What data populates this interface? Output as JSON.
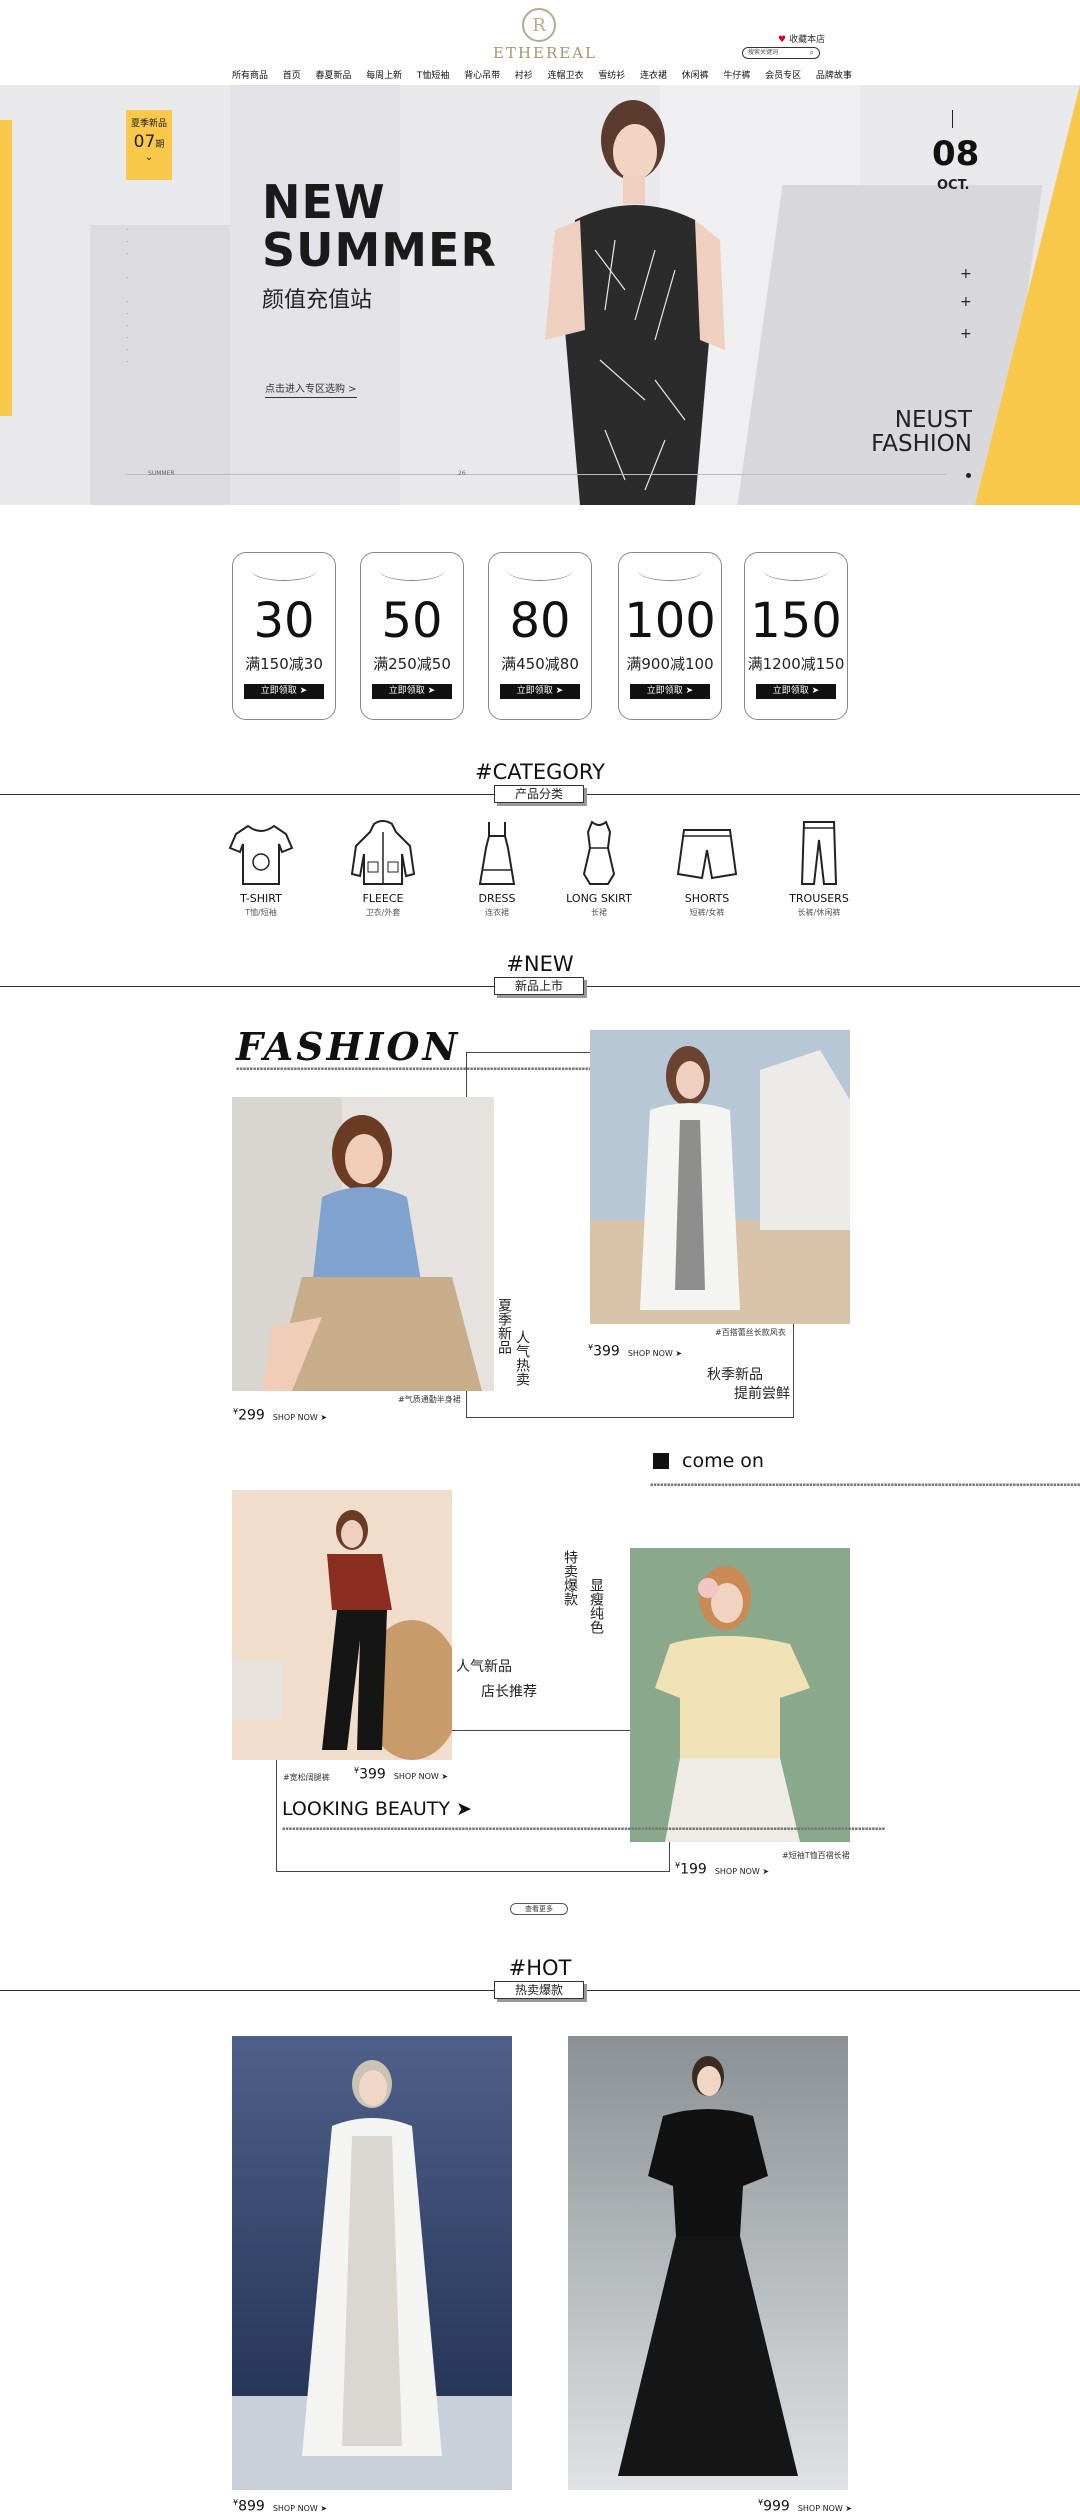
{
  "header": {
    "logo_mark": "R",
    "logo_text": "ETHEREAL",
    "favorite": "收藏本店",
    "search_placeholder": "搜索关键词",
    "nav": [
      "所有商品",
      "首页",
      "春夏新品",
      "每周上新",
      "T恤短袖",
      "背心吊带",
      "衬衫",
      "连帽卫衣",
      "雪纺衫",
      "连衣裙",
      "休闲裤",
      "牛仔裤",
      "会员专区",
      "品牌故事"
    ]
  },
  "hero": {
    "badge_top": "夏季新品",
    "badge_num": "07",
    "badge_unit": "期",
    "title_line1": "NEW",
    "title_line2": "SUMMER",
    "subtitle": "颜值充值站",
    "link": "点击进入专区选购 >",
    "date_day": "08",
    "date_month": "OCT.",
    "brand_line1": "NEUST",
    "brand_line2": "FASHION",
    "bottom_label": "SUMMER",
    "bottom_num": "26",
    "colors": {
      "accent": "#f7c84a",
      "bg": "#e9e9eb"
    }
  },
  "coupons": [
    {
      "value": "30",
      "condition": "满150减30",
      "button": "立即领取 ➤"
    },
    {
      "value": "50",
      "condition": "满250减50",
      "button": "立即领取 ➤"
    },
    {
      "value": "80",
      "condition": "满450减80",
      "button": "立即领取 ➤"
    },
    {
      "value": "100",
      "condition": "满900减100",
      "button": "立即领取 ➤"
    },
    {
      "value": "150",
      "condition": "满1200减150",
      "button": "立即领取 ➤"
    }
  ],
  "category": {
    "title": "#CATEGORY",
    "subtitle": "产品分类",
    "items": [
      {
        "en": "T-SHIRT",
        "zh": "T恤/短袖",
        "icon": "tshirt-icon"
      },
      {
        "en": "FLEECE",
        "zh": "卫衣/外套",
        "icon": "hoodie-icon"
      },
      {
        "en": "DRESS",
        "zh": "连衣裙",
        "icon": "dress-icon"
      },
      {
        "en": "LONG SKIRT",
        "zh": "长裙",
        "icon": "long-skirt-icon"
      },
      {
        "en": "SHORTS",
        "zh": "短裤/女裤",
        "icon": "shorts-icon"
      },
      {
        "en": "TROUSERS",
        "zh": "长裤/休闲裤",
        "icon": "trousers-icon"
      }
    ]
  },
  "new_section": {
    "title": "#NEW",
    "subtitle": "新品上市",
    "fashion_word": "FASHION",
    "block1": {
      "vertical_a": "夏季新品",
      "vertical_b": "人气热卖",
      "caption_left": "#气质通勤半身裙",
      "price_left": "299",
      "caption_right": "#百搭蕾丝长款风衣",
      "price_right": "399",
      "tagline_1": "秋季新品",
      "tagline_2": "提前尝鲜",
      "currency": "¥",
      "shop_now": "SHOP NOW ➤"
    },
    "block2": {
      "come_on": "come on",
      "vertical_a": "特卖爆款",
      "vertical_b": "显瘦纯色",
      "tagline_1": "人气新品",
      "tagline_2": "店长推荐",
      "caption_left": "#宽松阔腿裤",
      "price_left": "399",
      "caption_right": "#短袖T恤百褶长裙",
      "price_right": "199",
      "looking": "LOOKING BEAUTY ➤",
      "currency": "¥",
      "shop_now": "SHOP NOW ➤"
    },
    "more": "查看更多"
  },
  "hot": {
    "title": "#HOT",
    "subtitle": "热卖爆款",
    "prices": [
      "899",
      "999"
    ],
    "currency": "¥",
    "shop_now": "SHOP NOW ➤"
  }
}
